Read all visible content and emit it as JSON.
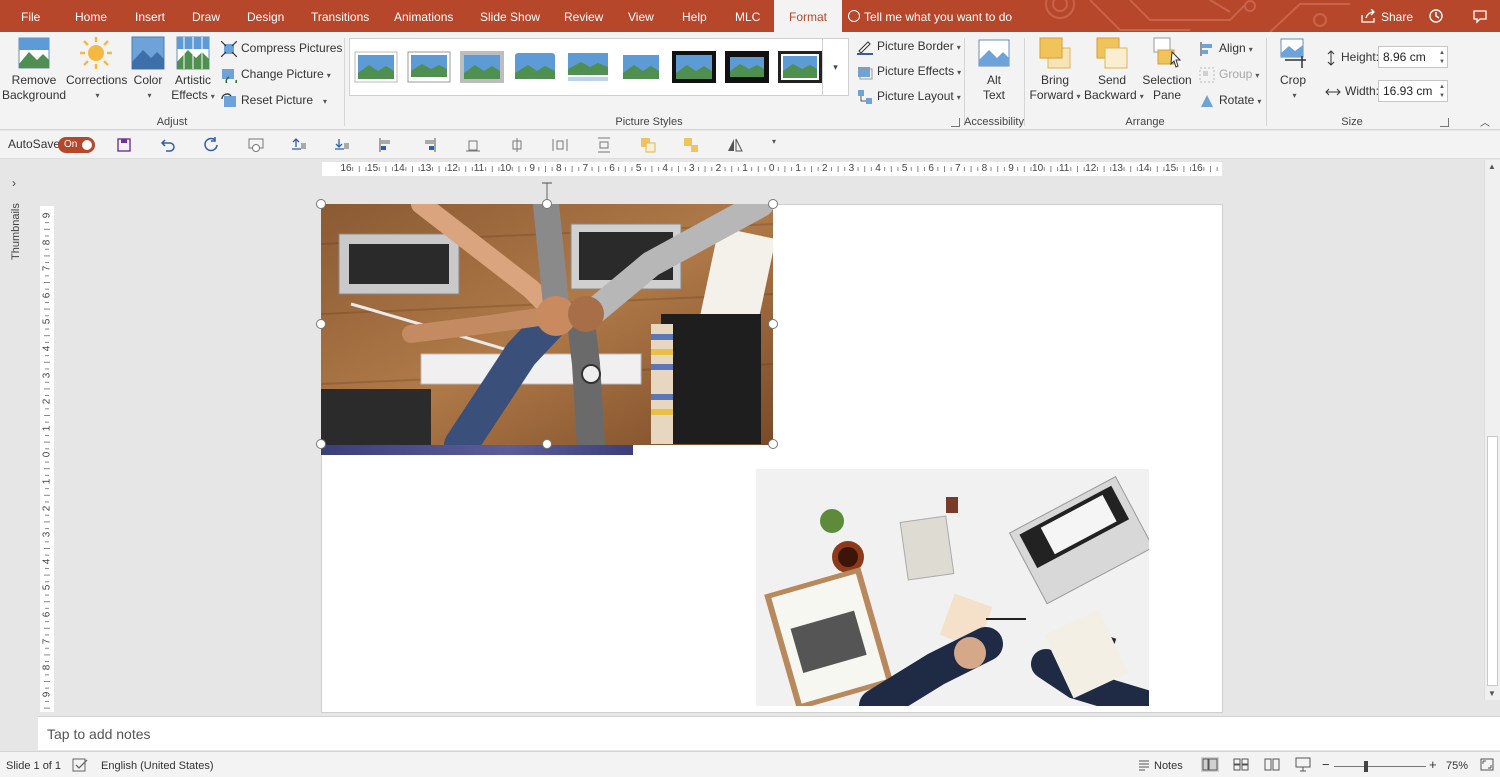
{
  "tabs": [
    {
      "label": "File",
      "active": false
    },
    {
      "label": "Home",
      "active": false
    },
    {
      "label": "Insert",
      "active": false
    },
    {
      "label": "Draw",
      "active": false
    },
    {
      "label": "Design",
      "active": false
    },
    {
      "label": "Transitions",
      "active": false
    },
    {
      "label": "Animations",
      "active": false
    },
    {
      "label": "Slide Show",
      "active": false
    },
    {
      "label": "Review",
      "active": false
    },
    {
      "label": "View",
      "active": false
    },
    {
      "label": "Help",
      "active": false
    },
    {
      "label": "MLC",
      "active": false
    },
    {
      "label": "Format",
      "active": true
    }
  ],
  "tell_me": "Tell me what you want to do",
  "share": "Share",
  "colors": {
    "accent": "#b7472a",
    "ribbon": "#f3f3f3",
    "workspace": "#e6e6e6"
  },
  "adjust": {
    "remove_bg_1": "Remove",
    "remove_bg_2": "Background",
    "corrections": "Corrections",
    "color": "Color",
    "artistic_1": "Artistic",
    "artistic_2": "Effects",
    "compress": "Compress Pictures",
    "change": "Change Picture",
    "reset": "Reset Picture",
    "label": "Adjust"
  },
  "picture_styles": {
    "label": "Picture Styles",
    "border": "Picture Border",
    "effects": "Picture Effects",
    "layout": "Picture Layout"
  },
  "accessibility": {
    "alt_1": "Alt",
    "alt_2": "Text",
    "label": "Accessibility"
  },
  "arrange": {
    "bring_1": "Bring",
    "bring_2": "Forward",
    "send_1": "Send",
    "send_2": "Backward",
    "selection_1": "Selection",
    "selection_2": "Pane",
    "align": "Align",
    "group": "Group",
    "rotate": "Rotate",
    "label": "Arrange"
  },
  "size": {
    "crop": "Crop",
    "height_label": "Height:",
    "height_value": "8.96 cm",
    "width_label": "Width:",
    "width_value": "16.93 cm",
    "label": "Size"
  },
  "qat": {
    "autosave": "AutoSave",
    "toggle": "On"
  },
  "ruler_h": [
    "16",
    "15",
    "14",
    "13",
    "12",
    "11",
    "10",
    "9",
    "8",
    "7",
    "6",
    "5",
    "4",
    "3",
    "2",
    "1",
    "0",
    "1",
    "2",
    "3",
    "4",
    "5",
    "6",
    "7",
    "8",
    "9",
    "10",
    "11",
    "12",
    "13",
    "14",
    "15",
    "16"
  ],
  "ruler_v": [
    "9",
    "8",
    "7",
    "6",
    "5",
    "4",
    "3",
    "2",
    "1",
    "0",
    "1",
    "2",
    "3",
    "4",
    "5",
    "6",
    "7",
    "8",
    "9"
  ],
  "thumbnails": "Thumbnails",
  "notes_placeholder": "Tap to add notes",
  "status": {
    "slide": "Slide 1 of 1",
    "language": "English (United States)",
    "notes": "Notes",
    "zoom": "75%"
  }
}
